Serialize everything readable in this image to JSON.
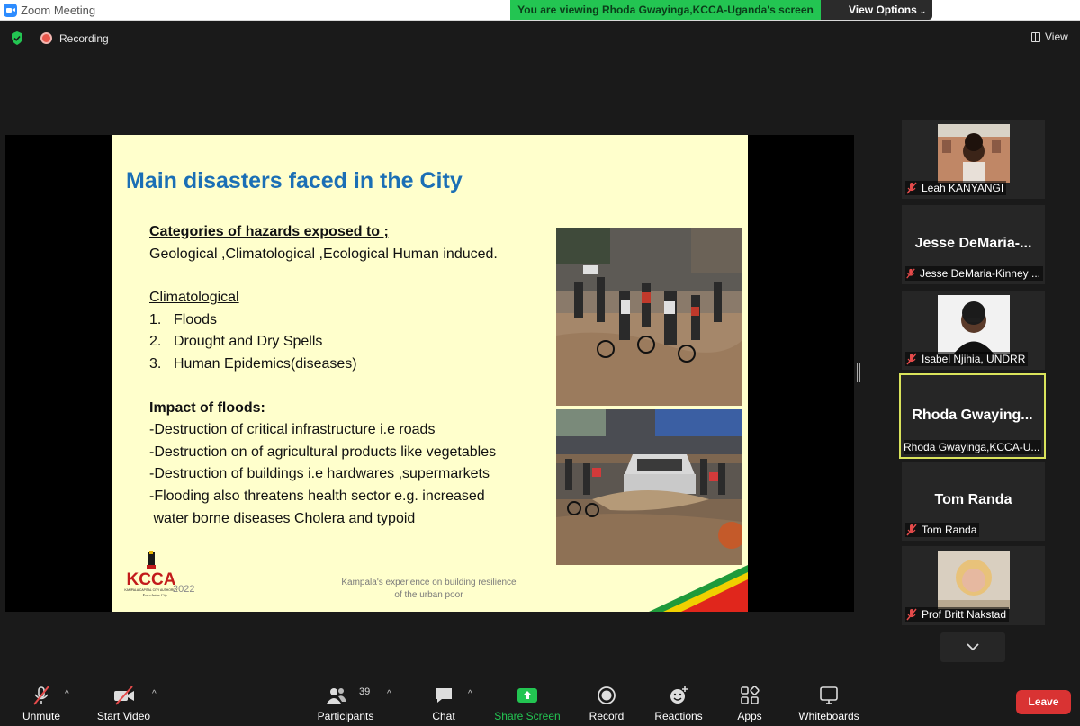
{
  "window": {
    "title": "Zoom Meeting"
  },
  "share_banner": {
    "text": "You are viewing Rhoda Gwayinga,KCCA-Uganda's screen",
    "view_options_label": "View Options"
  },
  "status": {
    "recording_label": "Recording",
    "view_label": "View"
  },
  "slide": {
    "title": "Main disasters faced in the City",
    "categories_heading": "Categories of hazards exposed to ;",
    "categories_text": "Geological ,Climatological ,Ecological Human induced.",
    "climatological_heading": "Climatological",
    "climatological_items": [
      {
        "num": "1.",
        "text": "Floods"
      },
      {
        "num": "2.",
        "text": "Drought and Dry Spells"
      },
      {
        "num": "3.",
        "text": "Human Epidemics(diseases)"
      }
    ],
    "impact_heading": "Impact of floods:",
    "impact_lines": [
      "-Destruction of critical infrastructure i.e roads",
      "-Destruction on of agricultural products like vegetables",
      "-Destruction of buildings i.e hardwares ,supermarkets",
      "-Flooding also threatens health sector e.g. increased",
      " water borne diseases Cholera and typoid"
    ],
    "logo_text": "KCCA",
    "logo_subtext": "KAMPALA CAPITAL CITY AUTHORITY",
    "logo_tagline": "For a better City",
    "date": "2022",
    "footer_line1": "Kampala's experience on building resilience",
    "footer_line2": "of the urban poor"
  },
  "participants": [
    {
      "name": "Leah KANYANGI",
      "display": "",
      "has_video": true
    },
    {
      "name": "Jesse DeMaria-Kinney ...",
      "display": "Jesse  DeMaria-...",
      "has_video": false
    },
    {
      "name": "Isabel Njihia, UNDRR",
      "display": "",
      "has_video": true
    },
    {
      "name": "Rhoda Gwayinga,KCCA-U...",
      "display": "Rhoda  Gwaying...",
      "has_video": false,
      "active": true
    },
    {
      "name": "Tom Randa",
      "display": "Tom Randa",
      "has_video": false
    },
    {
      "name": "Prof Britt Nakstad",
      "display": "",
      "has_video": true
    }
  ],
  "toolbar": {
    "unmute": "Unmute",
    "start_video": "Start Video",
    "participants": "Participants",
    "participants_count": "39",
    "chat": "Chat",
    "share_screen": "Share Screen",
    "record": "Record",
    "reactions": "Reactions",
    "apps": "Apps",
    "whiteboards": "Whiteboards",
    "leave": "Leave"
  },
  "colors": {
    "banner_green": "#23c552",
    "slide_bg": "#ffffcc",
    "slide_title": "#1b6fb5",
    "active_border": "#d9e35b",
    "leave_red": "#d93333"
  }
}
